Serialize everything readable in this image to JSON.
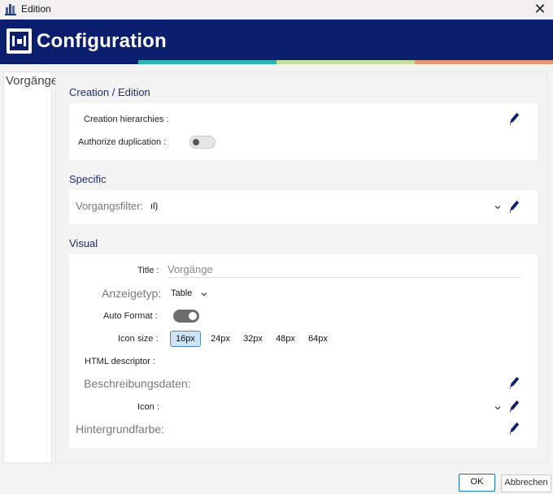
{
  "window": {
    "title": "Edition",
    "close_glyph": "✕",
    "icon": "app-icon"
  },
  "header": {
    "title": "Configuration",
    "logo": "configuration-logo-icon",
    "background": "#0b1f6e"
  },
  "stripe_colors": [
    "#0b1f6e",
    "#2bb5b0",
    "#c8df9a",
    "#e59a6e"
  ],
  "left_panel": {
    "items": [
      "Vorgänge"
    ]
  },
  "sections": {
    "creation": {
      "title": "Creation / Edition",
      "hierarchies_label": "Creation hierarchies :",
      "duplication_label": "Authorize duplication :",
      "duplication_enabled": false
    },
    "specific": {
      "title": "Specific",
      "filter_label": "Vorgangsfilter:",
      "filter_value": "ıl)"
    },
    "visual": {
      "title": "Visual",
      "title_label": "Title :",
      "title_placeholder": "Vorgänge",
      "display_type_label": "Anzeigetyp:",
      "display_type_value": "Table",
      "auto_format_label": "Auto Format :",
      "auto_format_enabled": true,
      "icon_size_label": "Icon size :",
      "icon_sizes": [
        "16px",
        "24px",
        "32px",
        "48px",
        "64px"
      ],
      "icon_size_selected": "16px",
      "html_descriptor_label": "HTML descriptor :",
      "description_data_label": "Beschreibungsdaten:",
      "icon_label": "Icon :",
      "background_color_label": "Hintergrundfarbe:"
    }
  },
  "buttons": {
    "ok": "OK",
    "cancel": "Abbrechen"
  }
}
